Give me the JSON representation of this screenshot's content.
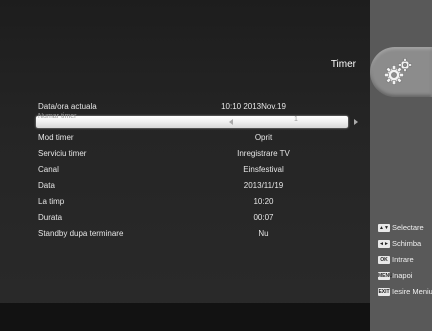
{
  "header": {
    "title": "Timer"
  },
  "current_time": {
    "label": "Data/ora actuala",
    "value": "10:10 2013Nov.19"
  },
  "selected_row": {
    "label": "Numar timer",
    "value": "1"
  },
  "rows": [
    {
      "label": "Mod timer",
      "value": "Oprit"
    },
    {
      "label": "Serviciu timer",
      "value": "Inregistrare TV"
    },
    {
      "label": "Canal",
      "value": "Einsfestival"
    },
    {
      "label": "Data",
      "value": "2013/11/19"
    },
    {
      "label": "La timp",
      "value": "10:20"
    },
    {
      "label": "Durata",
      "value": "00:07"
    },
    {
      "label": "Standby dupa terminare",
      "value": "Nu"
    }
  ],
  "help": [
    {
      "key": "▲▼",
      "label": "Selectare",
      "icon": "up-down-key-icon"
    },
    {
      "key": "◄►",
      "label": "Schimba",
      "icon": "left-right-key-icon"
    },
    {
      "key": "OK",
      "label": "Intrare",
      "icon": "ok-key-icon"
    },
    {
      "key": "MENU",
      "label": "Inapoi",
      "icon": "menu-key-icon"
    },
    {
      "key": "EXIT",
      "label": "Iesire Meniu",
      "icon": "exit-key-icon"
    }
  ],
  "colors": {
    "background": "#252525",
    "side_panel": "#595959",
    "selection": "#f0f0f0"
  },
  "icons": {
    "header": "gears-icon"
  }
}
